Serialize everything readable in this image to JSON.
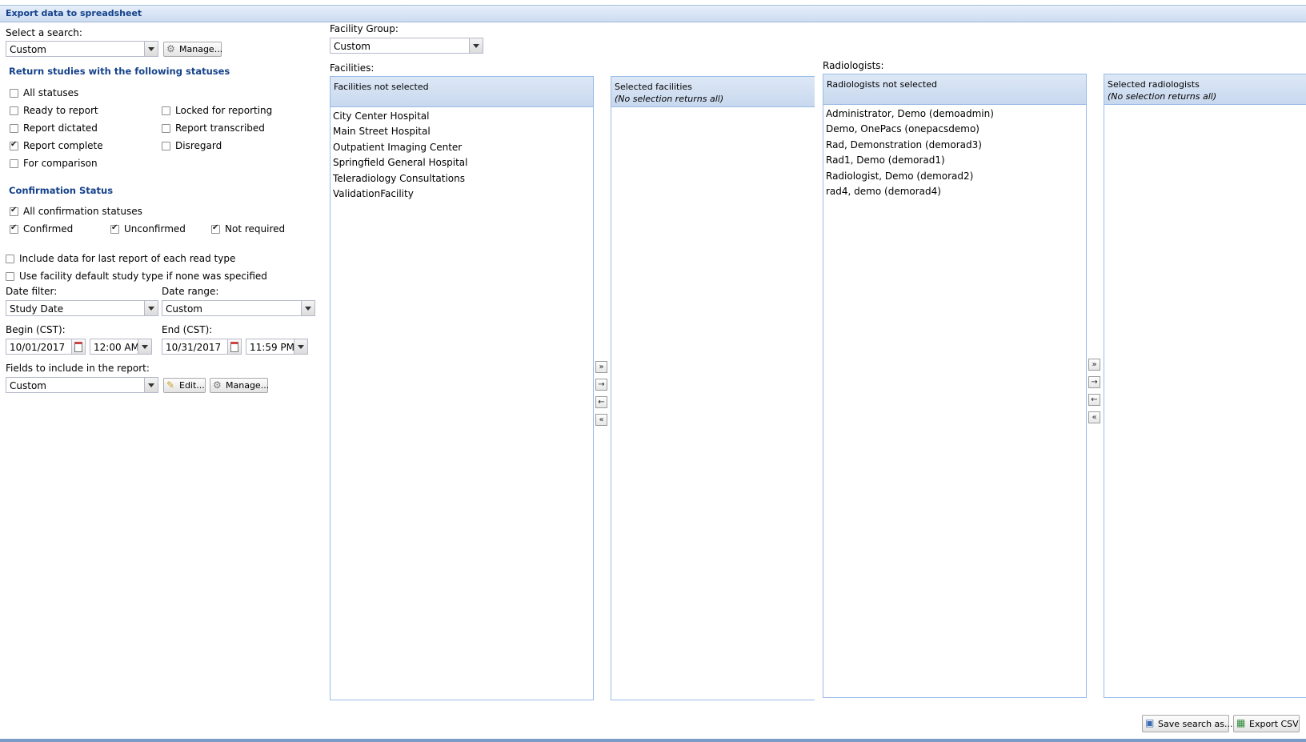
{
  "title": "Export data to spreadsheet",
  "search": {
    "label": "Select a search:",
    "value": "Custom",
    "manage_label": "Manage..."
  },
  "statuses": {
    "heading": "Return studies with the following statuses",
    "items": [
      {
        "label": "All statuses",
        "checked": false
      },
      {
        "label": "Ready to report",
        "checked": false
      },
      {
        "label": "Locked for reporting",
        "checked": false
      },
      {
        "label": "Report dictated",
        "checked": false
      },
      {
        "label": "Report transcribed",
        "checked": false
      },
      {
        "label": "Report complete",
        "checked": true
      },
      {
        "label": "Disregard",
        "checked": false
      },
      {
        "label": "For comparison",
        "checked": false
      }
    ]
  },
  "confirmation": {
    "heading": "Confirmation Status",
    "items": [
      {
        "label": "All confirmation statuses",
        "checked": true
      },
      {
        "label": "Confirmed",
        "checked": true
      },
      {
        "label": "Unconfirmed",
        "checked": true
      },
      {
        "label": "Not required",
        "checked": true
      }
    ]
  },
  "options": [
    {
      "label": "Include data for last report of each read type",
      "checked": false
    },
    {
      "label": "Use facility default study type if none was specified",
      "checked": false
    }
  ],
  "date_filter": {
    "label": "Date filter:",
    "value": "Study Date"
  },
  "date_range": {
    "label": "Date range:",
    "value": "Custom"
  },
  "begin": {
    "label": "Begin (CST):",
    "date": "10/01/2017",
    "time": "12:00 AM"
  },
  "end": {
    "label": "End (CST):",
    "date": "10/31/2017",
    "time": "11:59 PM"
  },
  "fields": {
    "label": "Fields to include in the report:",
    "value": "Custom",
    "edit_label": "Edit...",
    "manage_label": "Manage..."
  },
  "facility_group": {
    "label": "Facility Group:",
    "value": "Custom"
  },
  "facilities": {
    "label": "Facilities:",
    "not_selected_header": "Facilities not selected",
    "selected_header": "Selected facilities",
    "selected_subheader": "(No selection returns all)",
    "items": [
      "City Center Hospital",
      "Main Street Hospital",
      "Outpatient Imaging Center",
      "Springfield General Hospital",
      "Teleradiology Consultations",
      "ValidationFacility"
    ]
  },
  "radiologists": {
    "label": "Radiologists:",
    "not_selected_header": "Radiologists not selected",
    "selected_header": "Selected radiologists",
    "selected_subheader": "(No selection returns all)",
    "items": [
      "Administrator, Demo (demoadmin)",
      "Demo, OnePacs (onepacsdemo)",
      "Rad, Demonstration (demorad3)",
      "Rad1, Demo (demorad1)",
      "Radiologist, Demo (demorad2)",
      "rad4, demo (demorad4)"
    ]
  },
  "footer": {
    "save_label": "Save search as...",
    "export_label": "Export CSV"
  }
}
